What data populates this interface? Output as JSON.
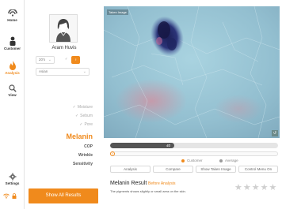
{
  "nav": {
    "items": [
      {
        "label": "Home",
        "icon": "home-icon"
      },
      {
        "label": "Customer",
        "icon": "customer-icon"
      },
      {
        "label": "Analysis",
        "icon": "analysis-icon",
        "active": true
      },
      {
        "label": "View",
        "icon": "search-icon"
      },
      {
        "label": "Settings",
        "icon": "gear-icon"
      }
    ]
  },
  "profile": {
    "name": "Aram Huvis",
    "age_range": "20's",
    "gender_symbols": [
      "♂",
      "♀"
    ],
    "race": "Asian"
  },
  "analysis_items": [
    {
      "label": "Moisture",
      "checked": true
    },
    {
      "label": "Sebum",
      "checked": true
    },
    {
      "label": "Pore",
      "checked": true
    },
    {
      "label": "Melanin",
      "active": true
    },
    {
      "label": "COP"
    },
    {
      "label": "Wrinkle"
    },
    {
      "label": "Sensitivity"
    }
  ],
  "show_all_label": "Show All Results",
  "image": {
    "tag": "Taken Image"
  },
  "slider": {
    "value": 40,
    "fraction": 0.38
  },
  "slider2": {
    "value": "0"
  },
  "legend": {
    "customer": "Customer",
    "average": "Average",
    "customer_color": "#f08a1c",
    "average_color": "#9a9a9a"
  },
  "buttons": [
    "Analysis",
    "Compare",
    "Show Taken Image",
    "Control Menu On"
  ],
  "result": {
    "title": "Melanin Result",
    "subtitle": "Before Analysis",
    "description": "The pigments shows slightly or small area on the skin.",
    "stars": 5,
    "filled": 0
  },
  "colors": {
    "accent": "#f08a1c"
  }
}
